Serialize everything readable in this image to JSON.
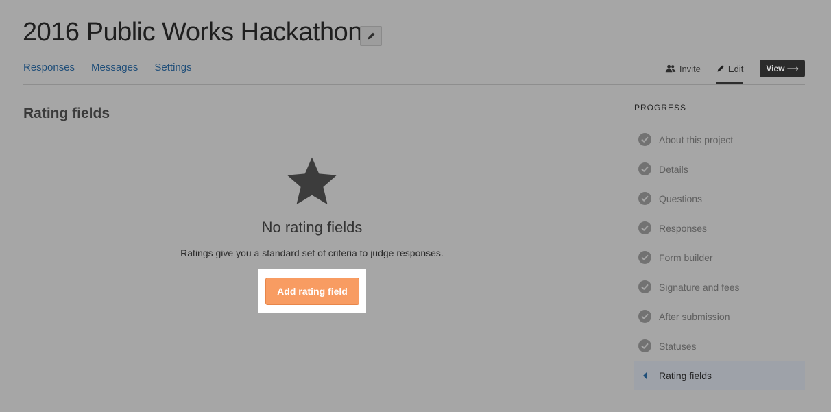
{
  "header": {
    "title": "2016 Public Works Hackathon",
    "edit_title_icon": "pencil-icon"
  },
  "tabs": [
    {
      "label": "Responses"
    },
    {
      "label": "Messages"
    },
    {
      "label": "Settings"
    }
  ],
  "actions": {
    "invite_label": "Invite",
    "edit_label": "Edit",
    "view_label": "View ⟶"
  },
  "main": {
    "section_title": "Rating fields",
    "empty_state": {
      "icon": "star-icon",
      "heading": "No rating fields",
      "description": "Ratings give you a standard set of criteria to judge responses.",
      "button_label": "Add rating field"
    }
  },
  "progress": {
    "label": "PROGRESS",
    "items": [
      {
        "label": "About this project",
        "status": "complete"
      },
      {
        "label": "Details",
        "status": "complete"
      },
      {
        "label": "Questions",
        "status": "complete"
      },
      {
        "label": "Responses",
        "status": "complete"
      },
      {
        "label": "Form builder",
        "status": "complete"
      },
      {
        "label": "Signature and fees",
        "status": "complete"
      },
      {
        "label": "After submission",
        "status": "complete"
      },
      {
        "label": "Statuses",
        "status": "complete"
      },
      {
        "label": "Rating fields",
        "status": "current"
      }
    ]
  },
  "colors": {
    "overlay_background": "#a6a6a6",
    "link": "#1f4e79",
    "accent_button": "#f89c62",
    "view_button": "#2b2b2b"
  }
}
